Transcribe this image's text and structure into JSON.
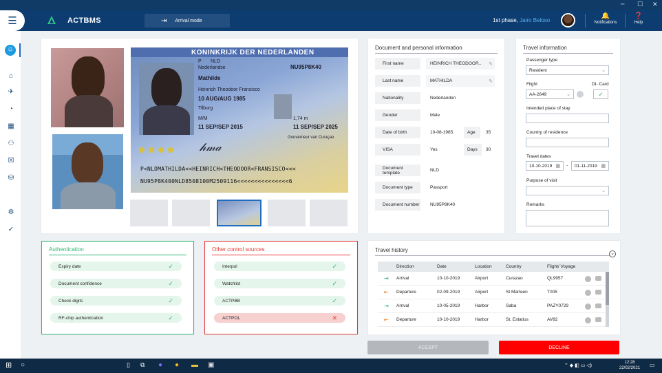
{
  "app": {
    "name": "ACTBMS",
    "mode": "Arrival mode"
  },
  "user": {
    "phase": "1st phase,",
    "name": "Jairo Beloso"
  },
  "header": {
    "notifications": "Notifications",
    "help": "Help"
  },
  "passport": {
    "title": "KONINKRIJK DER NEDERLANDEN",
    "type": "P",
    "country": "NLD",
    "nationality": "Nederlandse",
    "doc_number": "NU95P8K40",
    "surname": "Mathilde",
    "given": "Heinrich Theodoor Fransisco",
    "dob": "10 AUG/AUG 1985",
    "pob": "Tilburg",
    "sex": "M/M",
    "height": "1,74 m",
    "issue": "11 SEP/SEP 2015",
    "expiry": "11 SEP/SEP 2025",
    "authority": "Gouverneur van Curaçao",
    "mrz1": "P<NLDMATHILDA<<HEINRICH<THEODOOR<FRANSISCO<<<",
    "mrz2": "NU95P8K400NLD8508100M2509116<<<<<<<<<<<<<<<6"
  },
  "doc_info": {
    "title": "Document and personal information",
    "first_name_label": "First name",
    "first_name": "HEINRICH THEODOOR..",
    "last_name_label": "Last name",
    "last_name": "MATHILDA",
    "nationality_label": "Nationality",
    "nationality": "Nederlanden",
    "gender_label": "Gender",
    "gender": "Male",
    "dob_label": "Date of birth",
    "dob": "10-08-1985",
    "age_label": "Age",
    "age": "35",
    "visa_label": "VISA",
    "visa": "Yes",
    "days_label": "Days",
    "days": "30",
    "template_label": "Document template",
    "template": "NLD",
    "doctype_label": "Document type",
    "doctype": "Passport",
    "docnum_label": "Document number",
    "docnum": "NU95P8K40"
  },
  "travel_info": {
    "title": "Travel information",
    "passenger_type_label": "Passenger type",
    "passenger_type": "Resident",
    "flight_label": "Flight",
    "flight": "AA-2649",
    "dicard_label": "DI- Card",
    "stay_label": "Intended place of stay",
    "stay": "",
    "residence_label": "Country of residence",
    "residence": "",
    "dates_label": "Travel dates",
    "date_from": "10-10-2019",
    "date_sep": "-",
    "date_to": "01-11-2019",
    "purpose_label": "Purpose of visit",
    "purpose": "",
    "remarks_label": "Remarks",
    "remarks": ""
  },
  "authentication": {
    "title": "Authentication",
    "color": "#2eb873",
    "items": [
      "Expiry date",
      "Document confidence",
      "Check digits",
      "RF-chip authentication"
    ]
  },
  "other_sources": {
    "title": "Other control sources",
    "color": "#e53935",
    "items": [
      "Interpol",
      "Watchlist",
      "ACTPBB",
      "ACTPOL"
    ],
    "status": [
      "ok",
      "ok",
      "ok",
      "fail"
    ]
  },
  "travel_history": {
    "title": "Travel history",
    "headers": [
      "Direction",
      "Date",
      "Location",
      "Country",
      "Flight/ Voyage"
    ],
    "rows": [
      {
        "direction": "Arrival",
        "date": "10-10-2019",
        "location": "Airport",
        "country": "Curazao",
        "flight": "QL9957"
      },
      {
        "direction": "Departure",
        "date": "02-09-2019",
        "location": "Airport",
        "country": "St Marteen",
        "flight": "T005"
      },
      {
        "direction": "Arrival",
        "date": "10-05-2019",
        "location": "Harbor",
        "country": "Saba",
        "flight": "PAZY0729"
      },
      {
        "direction": "Departure",
        "date": "10-10-2019",
        "location": "Harbor",
        "country": "St. Estatius",
        "flight": "AV82"
      }
    ]
  },
  "actions": {
    "accept": "ACCEPT",
    "decline": "DECLINE"
  },
  "taskbar": {
    "time": "12:28",
    "date": "22/02/2021"
  }
}
